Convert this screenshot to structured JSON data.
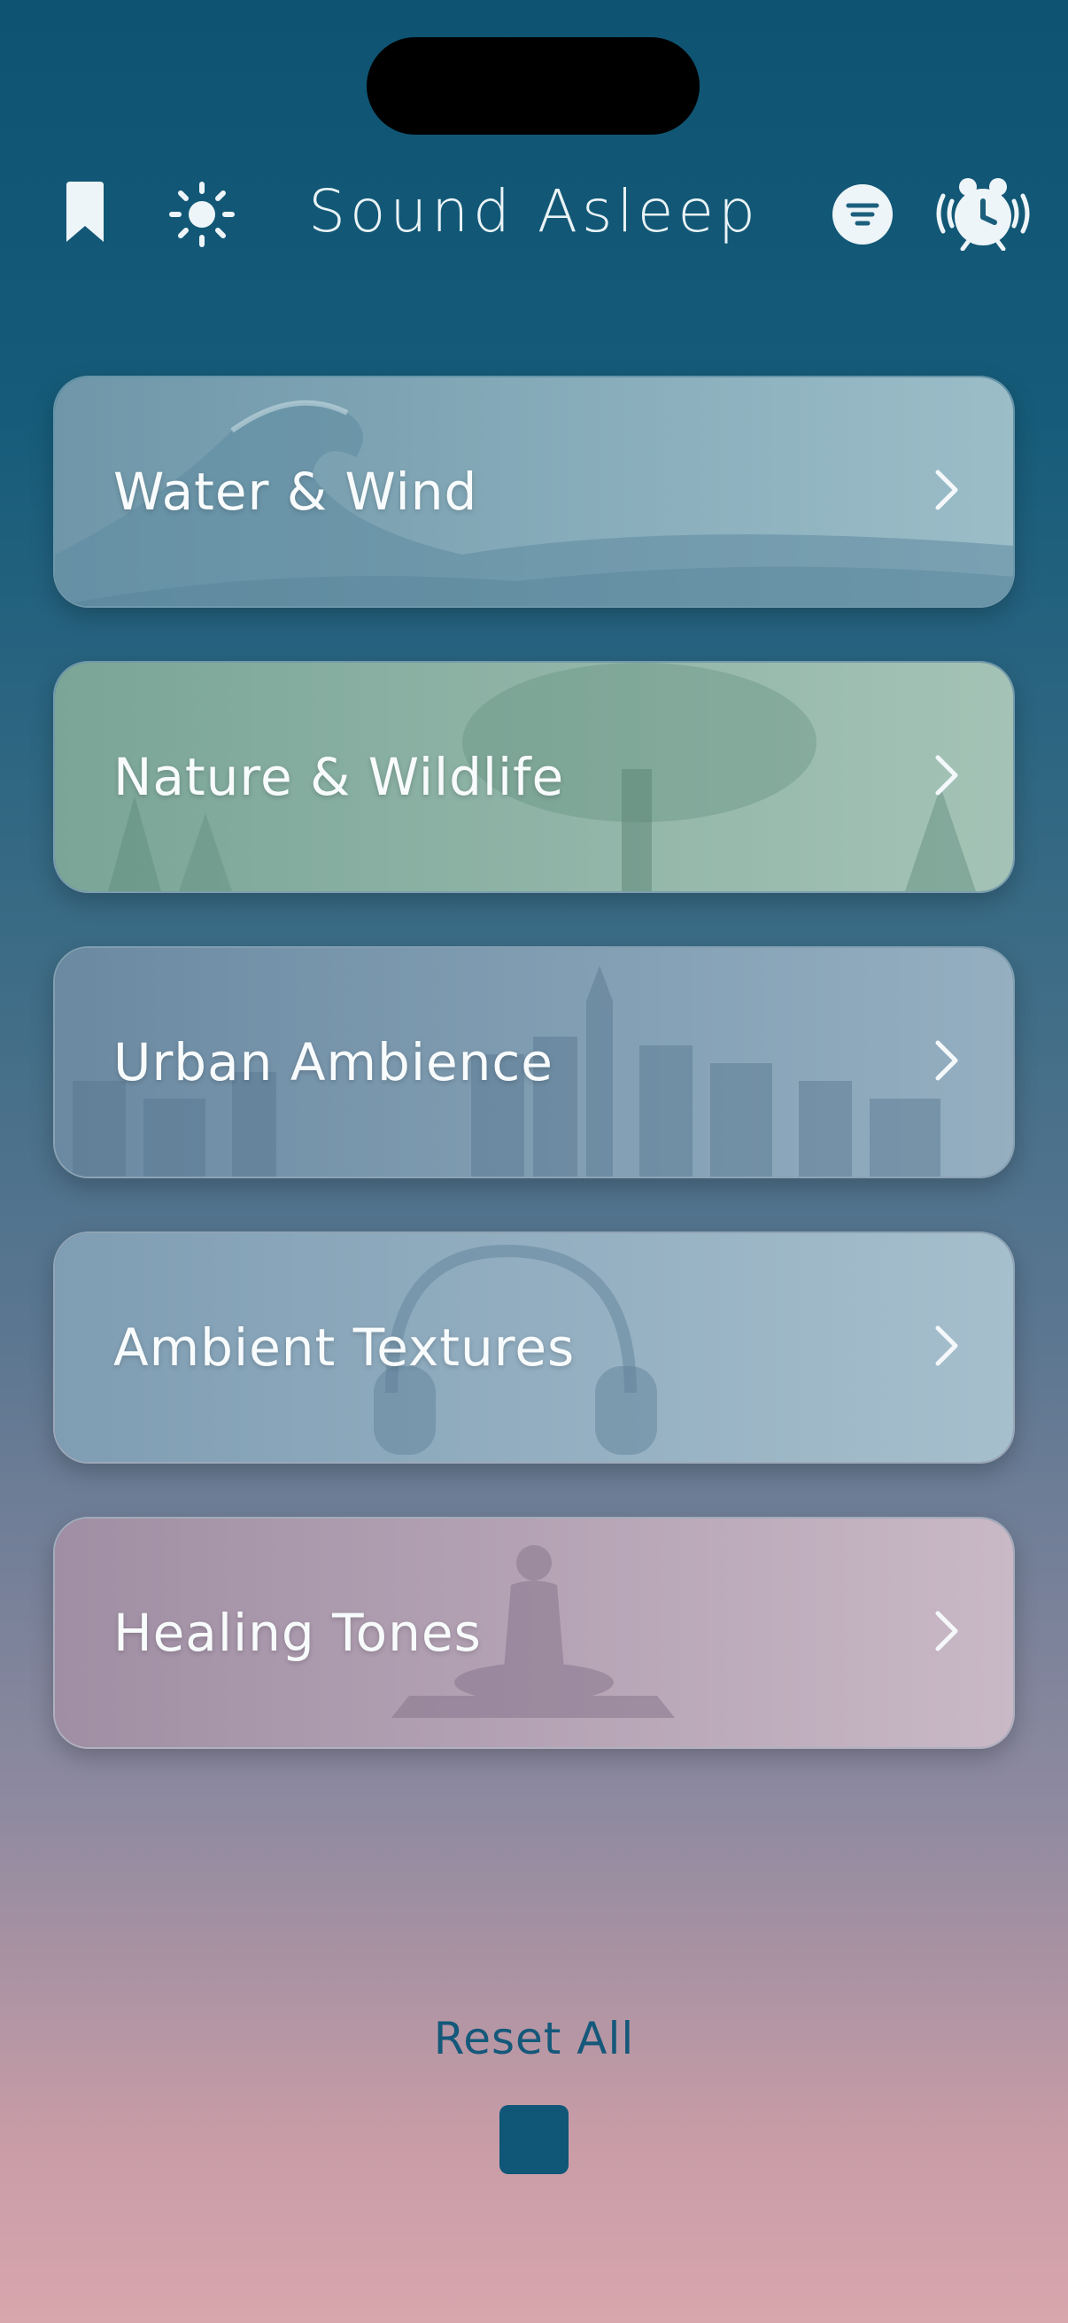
{
  "header": {
    "title": "Sound Asleep",
    "left_icons": [
      "bookmark-icon",
      "sun-icon"
    ],
    "right_icons": [
      "filter-icon",
      "alarm-clock-icon"
    ]
  },
  "categories": [
    {
      "label": "Water & Wind",
      "theme": "wave",
      "tint": "#8fb4c0"
    },
    {
      "label": "Nature & Wildlife",
      "theme": "tree",
      "tint": "#8eb2a4"
    },
    {
      "label": "Urban Ambience",
      "theme": "city",
      "tint": "#7f9ab0"
    },
    {
      "label": "Ambient Textures",
      "theme": "headphones",
      "tint": "#8da7bb"
    },
    {
      "label": "Healing Tones",
      "theme": "meditation",
      "tint": "#b9a7b6"
    }
  ],
  "footer": {
    "reset_label": "Reset All",
    "stop_icon": "stop-icon"
  },
  "colors": {
    "accent": "#0f5677",
    "background_top": "#0e5371",
    "background_bottom": "#d8a6ad"
  }
}
